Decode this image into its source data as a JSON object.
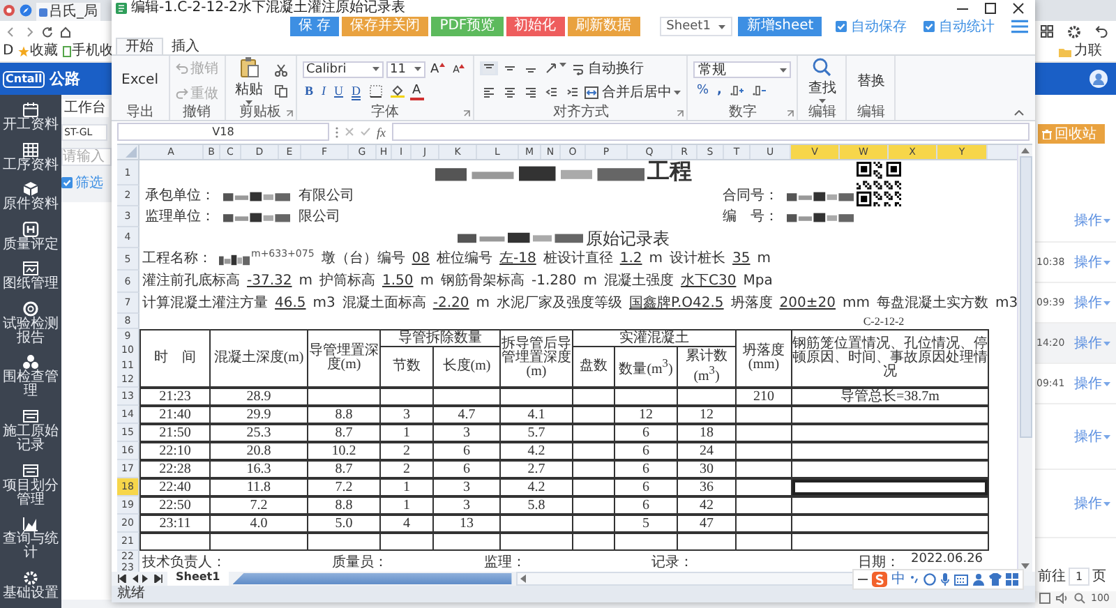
{
  "browser": {
    "tab_title": "吕氏_局",
    "bookmarks": [
      {
        "label": "D"
      },
      {
        "label": "收藏"
      },
      {
        "label": "手机收"
      }
    ],
    "right_bookmark": "力联"
  },
  "app": {
    "logo": "Cntall",
    "title": "公路",
    "sidebar": [
      {
        "label": "开工资料"
      },
      {
        "label": "工序资料"
      },
      {
        "label": "原件资料"
      },
      {
        "label": "质量评定"
      },
      {
        "label": "图纸管理"
      },
      {
        "label": "试验检测报告"
      },
      {
        "label": "围检查管理"
      },
      {
        "label": "施工原始记录"
      },
      {
        "label": "项目划分管理"
      },
      {
        "label": "查询与统计"
      },
      {
        "label": "基础设置"
      }
    ],
    "tab": "工作台",
    "project": "ST-GL",
    "search_placeholder": "请输入",
    "filter": {
      "label": "筛选",
      "checked": true
    },
    "recycle_button": "回收站",
    "list_rows": [
      {
        "action": "操作",
        "selected": false
      },
      {
        "time": "10:38",
        "action": "操作",
        "selected": false
      },
      {
        "time": "09:39",
        "action": "操作",
        "selected": false
      },
      {
        "time": "14:20",
        "action": "操作",
        "selected": true
      },
      {
        "time": "09:41",
        "action": "操作",
        "selected": false
      },
      {
        "action": "操作",
        "selected": false
      },
      {
        "action": "操作",
        "selected": false
      }
    ],
    "pagination": {
      "goto": "前往",
      "page": "1",
      "unit": "页"
    },
    "zoom": "100"
  },
  "dialog": {
    "title": "编辑-1.C-2-12-2水下混凝土灌注原始记录表",
    "actions": [
      {
        "label": "保 存",
        "color": "#3d8fe3"
      },
      {
        "label": "保存并关闭",
        "color": "#e9a23f"
      },
      {
        "label": "PDF预览",
        "color": "#5dba5d"
      },
      {
        "label": "初始化",
        "color": "#ee5d5d"
      },
      {
        "label": "刷新数据",
        "color": "#e9a23f"
      }
    ],
    "sheet_select": "Sheet1",
    "add_sheet": "新增sheet",
    "options": [
      {
        "label": "自动保存",
        "checked": true
      },
      {
        "label": "自动统计",
        "checked": true
      }
    ],
    "ribbon_tabs": [
      {
        "label": "开始",
        "selected": true
      },
      {
        "label": "插入",
        "selected": false
      }
    ],
    "ribbon": {
      "export": {
        "label": "Excel",
        "group": "导出"
      },
      "undo": {
        "items": [
          {
            "label": "撤销",
            "disabled": true
          },
          {
            "label": "重做",
            "disabled": true
          }
        ],
        "group": "撤销"
      },
      "clipboard": {
        "paste": "粘贴",
        "group": "剪贴板"
      },
      "font": {
        "name": "Calibri",
        "size": "11",
        "grow": "A",
        "shrink": "A",
        "styles": [
          "B",
          "I",
          "U",
          "D"
        ],
        "color_letter": "A",
        "group": "字体"
      },
      "align": {
        "wrap": "自动换行",
        "merge": "合并后居中",
        "group": "对齐方式"
      },
      "number": {
        "format": "常规",
        "percent": "%",
        "comma": ",",
        "group": "数字"
      },
      "find": {
        "label": "查找",
        "group": "编辑"
      },
      "replace": {
        "label": "替换",
        "group": "编辑"
      }
    },
    "name_box": "V18",
    "fx": "fx",
    "columns": [
      {
        "label": "A",
        "selected": false
      },
      {
        "label": "B",
        "selected": false
      },
      {
        "label": "C",
        "selected": false
      },
      {
        "label": "D",
        "selected": false
      },
      {
        "label": "E",
        "selected": false
      },
      {
        "label": "F",
        "selected": false
      },
      {
        "label": "G",
        "selected": false
      },
      {
        "label": "H",
        "selected": false
      },
      {
        "label": "I",
        "selected": false
      },
      {
        "label": "J",
        "selected": false
      },
      {
        "label": "K",
        "selected": false
      },
      {
        "label": "L",
        "selected": false
      },
      {
        "label": "M",
        "selected": false
      },
      {
        "label": "N",
        "selected": false
      },
      {
        "label": "O",
        "selected": false
      },
      {
        "label": "P",
        "selected": false
      },
      {
        "label": "Q",
        "selected": false
      },
      {
        "label": "R",
        "selected": false
      },
      {
        "label": "S",
        "selected": false
      },
      {
        "label": "T",
        "selected": false
      },
      {
        "label": "U",
        "selected": false
      },
      {
        "label": "V",
        "selected": true
      },
      {
        "label": "W",
        "selected": true
      },
      {
        "label": "X",
        "selected": true
      },
      {
        "label": "Y",
        "selected": true
      }
    ],
    "row_numbers": [
      {
        "label": "1",
        "selected": false
      },
      {
        "label": "2",
        "selected": false
      },
      {
        "label": "3",
        "selected": false
      },
      {
        "label": "4",
        "selected": false
      },
      {
        "label": "5",
        "selected": false
      },
      {
        "label": "6",
        "selected": false
      },
      {
        "label": "7",
        "selected": false
      },
      {
        "label": "8",
        "selected": false
      },
      {
        "label": "9",
        "selected": false
      },
      {
        "label": "10",
        "selected": false
      },
      {
        "label": "11",
        "selected": false
      },
      {
        "label": "12",
        "selected": false
      },
      {
        "label": "13",
        "selected": false
      },
      {
        "label": "14",
        "selected": false
      },
      {
        "label": "15",
        "selected": false
      },
      {
        "label": "16",
        "selected": false
      },
      {
        "label": "17",
        "selected": false
      },
      {
        "label": "18",
        "selected": true
      },
      {
        "label": "19",
        "selected": false
      },
      {
        "label": "20",
        "selected": false
      },
      {
        "label": "21",
        "selected": false
      },
      {
        "label": "22",
        "selected": false
      },
      {
        "label": "23",
        "selected": false
      }
    ],
    "form_rows": [
      [
        {
          "kind": "redacted"
        },
        {
          "kind": "title",
          "text": "工程"
        }
      ],
      [
        {
          "kind": "label",
          "text": "承包单位："
        },
        {
          "kind": "redacted"
        },
        {
          "kind": "label",
          "text": "有限公司"
        },
        {
          "kind": "label",
          "text": "合同号："
        },
        {
          "kind": "redacted"
        }
      ],
      [
        {
          "kind": "label",
          "text": "监理单位："
        },
        {
          "kind": "redacted"
        },
        {
          "kind": "label",
          "text": "限公司"
        },
        {
          "kind": "label",
          "text": "编　号："
        },
        {
          "kind": "redacted"
        }
      ],
      [
        {
          "kind": "redacted"
        },
        {
          "kind": "heading",
          "text": "原始记录表"
        }
      ],
      [
        {
          "kind": "label",
          "text": "工程名称："
        },
        {
          "kind": "redacted"
        },
        {
          "kind": "note",
          "text": "m+633+075"
        },
        {
          "kind": "label",
          "text": "墩（台）编号"
        },
        {
          "kind": "value",
          "text": "08"
        },
        {
          "kind": "label",
          "text": "桩位编号"
        },
        {
          "kind": "value",
          "text": "左-18"
        },
        {
          "kind": "label",
          "text": "桩设计直径"
        },
        {
          "kind": "value",
          "text": "1.2"
        },
        {
          "kind": "label",
          "text": "m"
        },
        {
          "kind": "label",
          "text": "设计桩长"
        },
        {
          "kind": "value",
          "text": "35"
        },
        {
          "kind": "label",
          "text": "m"
        }
      ],
      [
        {
          "kind": "label",
          "text": "灌注前孔底标高"
        },
        {
          "kind": "value",
          "text": "-37.32"
        },
        {
          "kind": "label",
          "text": "m"
        },
        {
          "kind": "label",
          "text": "护筒标高"
        },
        {
          "kind": "value",
          "text": "1.50"
        },
        {
          "kind": "label",
          "text": "m"
        },
        {
          "kind": "label",
          "text": "钢筋骨架标高"
        },
        {
          "kind": "label",
          "text": "-1.280"
        },
        {
          "kind": "label",
          "text": "m"
        },
        {
          "kind": "label",
          "text": "混凝土强度"
        },
        {
          "kind": "value",
          "text": "水下C30"
        },
        {
          "kind": "label",
          "text": "Mpa"
        }
      ],
      [
        {
          "kind": "label",
          "text": "计算混凝土灌注方量"
        },
        {
          "kind": "value",
          "text": "46.5"
        },
        {
          "kind": "label",
          "text": "m3"
        },
        {
          "kind": "label",
          "text": "混凝土面标高"
        },
        {
          "kind": "value",
          "text": "-2.20"
        },
        {
          "kind": "label",
          "text": "m"
        },
        {
          "kind": "label",
          "text": "水泥厂家及强度等级"
        },
        {
          "kind": "value",
          "text": "国鑫牌P.O42.5"
        },
        {
          "kind": "label",
          "text": "坍落度"
        },
        {
          "kind": "value",
          "text": "200±20"
        },
        {
          "kind": "label",
          "text": "mm"
        },
        {
          "kind": "label",
          "text": "每盘混凝土实方数"
        },
        {
          "kind": "label",
          "text": "m3"
        }
      ],
      [
        {
          "kind": "code",
          "text": "C-2-12-2"
        }
      ]
    ],
    "table": {
      "columns": [
        {
          "label": "时　间"
        },
        {
          "label": "混凝土深度(m)"
        },
        {
          "label": "导管埋置深度(m)"
        },
        {
          "label": "导管拆除数量",
          "colspan": 2,
          "children": [
            {
              "label": "节数"
            },
            {
              "label": "长度(m)"
            }
          ]
        },
        {
          "label": "拆导管后导管埋置深度(m)"
        },
        {
          "label": "实灌混凝土",
          "colspan": 3,
          "children": [
            {
              "label": "盘数"
            },
            {
              "label": "数量(m$^{3}$)"
            },
            {
              "label": "累计数(m$^{3}$)"
            }
          ]
        },
        {
          "label": "坍落度(mm)"
        },
        {
          "label": "钢筋笼位置情况、孔位情况、停顿原因、时间、事故原因处理情况"
        }
      ],
      "rows": [
        {
          "cells": [
            "21:23",
            "28.9",
            null,
            null,
            null,
            null,
            null,
            null,
            null,
            "210",
            "导管总长=38.7m"
          ],
          "selected": false
        },
        {
          "cells": [
            "21:40",
            "29.9",
            "8.8",
            "3",
            "4.7",
            "4.1",
            null,
            "12",
            "12",
            null,
            null
          ],
          "selected": false
        },
        {
          "cells": [
            "21:50",
            "25.3",
            "8.7",
            "1",
            "3",
            "5.7",
            null,
            "6",
            "18",
            null,
            null
          ],
          "selected": false
        },
        {
          "cells": [
            "22:10",
            "20.8",
            "10.2",
            "2",
            "6",
            "4.2",
            null,
            "6",
            "24",
            null,
            null
          ],
          "selected": false
        },
        {
          "cells": [
            "22:28",
            "16.3",
            "8.7",
            "2",
            "6",
            "2.7",
            null,
            "6",
            "30",
            null,
            null
          ],
          "selected": false
        },
        {
          "cells": [
            "22:40",
            "11.8",
            "7.2",
            "1",
            "3",
            "4.2",
            null,
            "6",
            "36",
            null,
            null
          ],
          "selected": true
        },
        {
          "cells": [
            "22:50",
            "7.2",
            "8.8",
            "1",
            "3",
            "5.8",
            null,
            "6",
            "42",
            null,
            null
          ],
          "selected": false
        },
        {
          "cells": [
            "23:11",
            "4.0",
            "5.0",
            "4",
            "13",
            null,
            null,
            "5",
            "47",
            null,
            null
          ],
          "selected": false
        },
        {
          "cells": [
            null,
            null,
            null,
            null,
            null,
            null,
            null,
            null,
            null,
            null,
            null
          ],
          "selected": false
        }
      ]
    },
    "signatures": [
      "技术负责人：",
      "质量员：",
      "监理：",
      "记录："
    ],
    "date": {
      "label": "日期：",
      "value": "2022.06.26"
    },
    "sheet_tabs": [
      {
        "label": "Sheet1",
        "selected": true
      }
    ],
    "status": "就绪",
    "ime": "中"
  }
}
